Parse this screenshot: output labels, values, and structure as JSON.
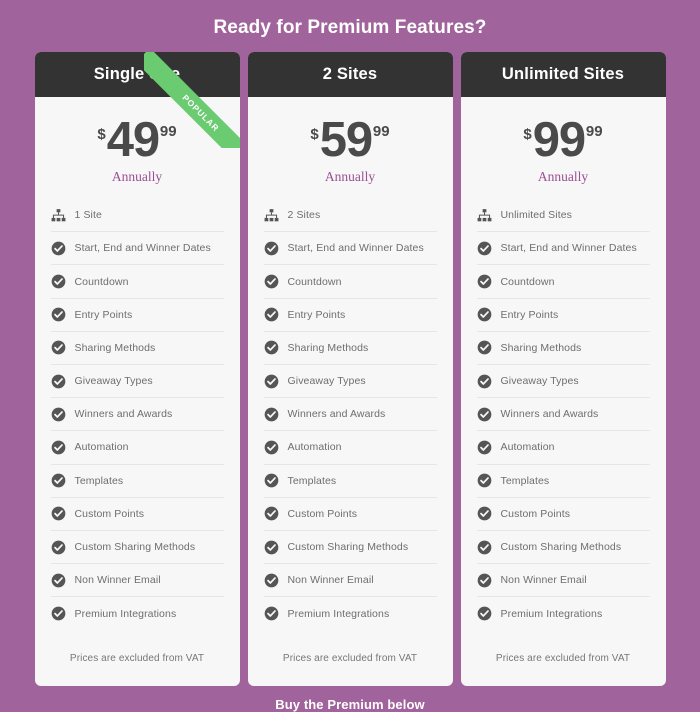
{
  "heading": "Ready for Premium Features?",
  "bottom_cta": "Buy the Premium below",
  "colors": {
    "background": "#a0639c",
    "card_header": "#333333",
    "card_body": "#f7f7f7",
    "ribbon": "#6acb71",
    "period_text": "#9b4f93",
    "price_text": "#4a4a4a",
    "feature_text": "#6e6e6e",
    "divider": "#e6e6e6"
  },
  "vat_note": "Prices are excluded from VAT",
  "ribbon_label": "POPULAR",
  "plans": [
    {
      "title": "Single Site",
      "currency": "$",
      "price": "49",
      "cents": "99",
      "period": "Annually",
      "popular": true,
      "features": [
        {
          "icon": "sitemap-icon",
          "label": "1 Site"
        },
        {
          "icon": "check-circle-icon",
          "label": "Start, End and Winner Dates"
        },
        {
          "icon": "check-circle-icon",
          "label": "Countdown"
        },
        {
          "icon": "check-circle-icon",
          "label": "Entry Points"
        },
        {
          "icon": "check-circle-icon",
          "label": "Sharing Methods"
        },
        {
          "icon": "check-circle-icon",
          "label": "Giveaway Types"
        },
        {
          "icon": "check-circle-icon",
          "label": "Winners and Awards"
        },
        {
          "icon": "check-circle-icon",
          "label": "Automation"
        },
        {
          "icon": "check-circle-icon",
          "label": "Templates"
        },
        {
          "icon": "check-circle-icon",
          "label": "Custom Points"
        },
        {
          "icon": "check-circle-icon",
          "label": "Custom Sharing Methods"
        },
        {
          "icon": "check-circle-icon",
          "label": "Non Winner Email"
        },
        {
          "icon": "check-circle-icon",
          "label": "Premium Integrations"
        }
      ]
    },
    {
      "title": "2 Sites",
      "currency": "$",
      "price": "59",
      "cents": "99",
      "period": "Annually",
      "popular": false,
      "features": [
        {
          "icon": "sitemap-icon",
          "label": "2 Sites"
        },
        {
          "icon": "check-circle-icon",
          "label": "Start, End and Winner Dates"
        },
        {
          "icon": "check-circle-icon",
          "label": "Countdown"
        },
        {
          "icon": "check-circle-icon",
          "label": "Entry Points"
        },
        {
          "icon": "check-circle-icon",
          "label": "Sharing Methods"
        },
        {
          "icon": "check-circle-icon",
          "label": "Giveaway Types"
        },
        {
          "icon": "check-circle-icon",
          "label": "Winners and Awards"
        },
        {
          "icon": "check-circle-icon",
          "label": "Automation"
        },
        {
          "icon": "check-circle-icon",
          "label": "Templates"
        },
        {
          "icon": "check-circle-icon",
          "label": "Custom Points"
        },
        {
          "icon": "check-circle-icon",
          "label": "Custom Sharing Methods"
        },
        {
          "icon": "check-circle-icon",
          "label": "Non Winner Email"
        },
        {
          "icon": "check-circle-icon",
          "label": "Premium Integrations"
        }
      ]
    },
    {
      "title": "Unlimited Sites",
      "currency": "$",
      "price": "99",
      "cents": "99",
      "period": "Annually",
      "popular": false,
      "features": [
        {
          "icon": "sitemap-icon",
          "label": "Unlimited Sites"
        },
        {
          "icon": "check-circle-icon",
          "label": "Start, End and Winner Dates"
        },
        {
          "icon": "check-circle-icon",
          "label": "Countdown"
        },
        {
          "icon": "check-circle-icon",
          "label": "Entry Points"
        },
        {
          "icon": "check-circle-icon",
          "label": "Sharing Methods"
        },
        {
          "icon": "check-circle-icon",
          "label": "Giveaway Types"
        },
        {
          "icon": "check-circle-icon",
          "label": "Winners and Awards"
        },
        {
          "icon": "check-circle-icon",
          "label": "Automation"
        },
        {
          "icon": "check-circle-icon",
          "label": "Templates"
        },
        {
          "icon": "check-circle-icon",
          "label": "Custom Points"
        },
        {
          "icon": "check-circle-icon",
          "label": "Custom Sharing Methods"
        },
        {
          "icon": "check-circle-icon",
          "label": "Non Winner Email"
        },
        {
          "icon": "check-circle-icon",
          "label": "Premium Integrations"
        }
      ]
    }
  ]
}
